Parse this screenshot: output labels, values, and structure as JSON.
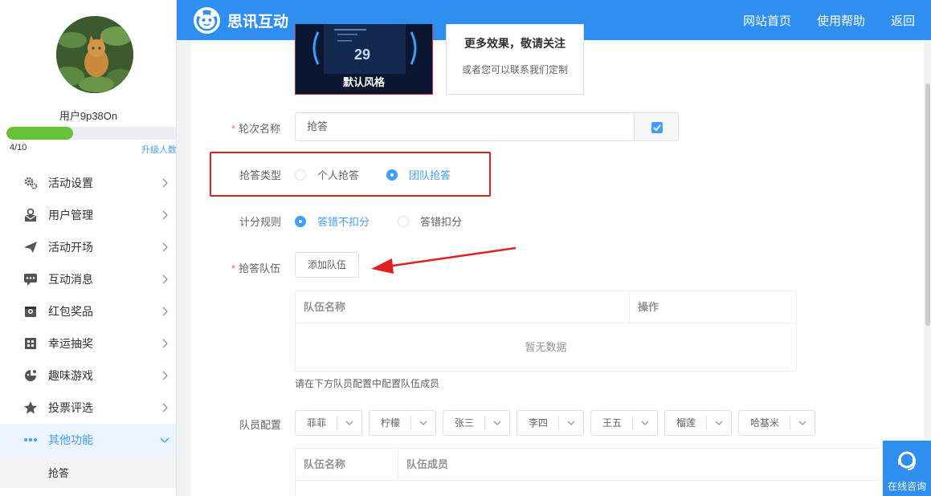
{
  "sidebar": {
    "username": "用户9p38On",
    "progress": {
      "text": "4/10",
      "fraction": 0.4
    },
    "upgrade_label": "升级人数",
    "menu": [
      {
        "label": "活动设置",
        "icon": "gear-icon"
      },
      {
        "label": "用户管理",
        "icon": "user-mail-icon"
      },
      {
        "label": "活动开场",
        "icon": "paper-plane-icon"
      },
      {
        "label": "互动消息",
        "icon": "chat-bubble-icon"
      },
      {
        "label": "红包奖品",
        "icon": "gift-box-icon"
      },
      {
        "label": "幸运抽奖",
        "icon": "lottery-icon"
      },
      {
        "label": "趣味游戏",
        "icon": "game-icon"
      },
      {
        "label": "投票评选",
        "icon": "star-icon"
      },
      {
        "label": "其他功能",
        "icon": "more-dots-icon"
      }
    ],
    "submenu_active": "抢答"
  },
  "header": {
    "brand": "思讯互动",
    "nav": [
      "网站首页",
      "使用帮助",
      "返回"
    ]
  },
  "form": {
    "theme_card_label": "默认风格",
    "theme_preview_number": "29",
    "more_card_title": "更多效果，敬请关注",
    "more_card_subtitle": "或者您可以联系我们定制",
    "round_name_label": "轮次名称",
    "round_name_value": "抢答",
    "quiz_type_label": "抢答类型",
    "quiz_type_options": [
      "个人抢答",
      "团队抢答"
    ],
    "quiz_type_selected": 1,
    "score_rule_label": "计分规则",
    "score_rule_options": [
      "答错不扣分",
      "答错扣分"
    ],
    "score_rule_selected": 0,
    "team_label": "抢答队伍",
    "add_team_button": "添加队伍",
    "team_table": {
      "headers": [
        "队伍名称",
        "操作"
      ],
      "empty_text": "暂无数据"
    },
    "hint": "请在下方队员配置中配置队伍成员",
    "member_config_label": "队员配置",
    "member_selects": [
      "菲菲",
      "柠檬",
      "张三",
      "李四",
      "王五",
      "榴莲",
      "哈基米"
    ],
    "member_table": {
      "headers": [
        "队伍名称",
        "队伍成员"
      ]
    }
  },
  "consult": {
    "label": "在线咨询"
  },
  "colors": {
    "primary": "#2f8ff0",
    "accent": "#409eff",
    "highlight": "#e02020",
    "progress": "#67c23a"
  }
}
